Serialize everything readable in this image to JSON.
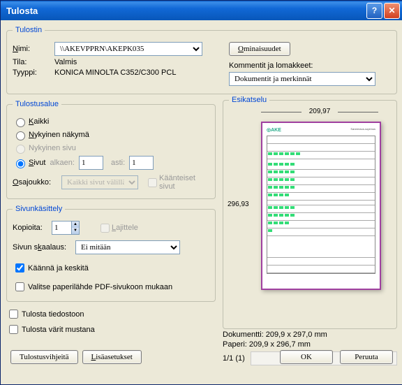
{
  "title": "Tulosta",
  "printer": {
    "legend": "Tulostin",
    "name_label": "Nimi:",
    "name_value": "\\\\AKEVPPRN\\AKEPK035",
    "status_label": "Tila:",
    "status_value": "Valmis",
    "type_label": "Tyyppi:",
    "type_value": "KONICA MINOLTA C352/C300 PCL",
    "properties_btn": "Ominaisuudet",
    "comments_label": "Kommentit ja lomakkeet:",
    "comments_value": "Dokumentit ja merkinnät"
  },
  "range": {
    "legend": "Tulostusalue",
    "all": "Kaikki",
    "current_view": "Nykyinen näkymä",
    "current_page": "Nykyinen sivu",
    "pages": "Sivut",
    "from_label": "alkaen:",
    "from_value": "1",
    "to_label": "asti:",
    "to_value": "1",
    "subset_label": "Osajoukko:",
    "subset_value": "Kaikki sivut välillä",
    "reverse": "Käänteiset sivut"
  },
  "handling": {
    "legend": "Sivunkäsittely",
    "copies_label": "Kopioita:",
    "copies_value": "1",
    "collate": "Lajittele",
    "scaling_label": "Sivun skaalaus:",
    "scaling_value": "Ei mitään",
    "rotate_center": "Käännä ja keskitä",
    "paper_source": "Valitse paperilähde PDF-sivukoon mukaan"
  },
  "misc": {
    "print_to_file": "Tulosta tiedostoon",
    "print_bw": "Tulosta värit mustana"
  },
  "preview": {
    "legend": "Esikatselu",
    "width": "209,97",
    "height": "296,93",
    "doc_info": "Dokumentti: 209,9 x 297,0 mm",
    "paper_info": "Paperi: 209,9 x 296,7 mm",
    "page_status": "1/1 (1)"
  },
  "buttons": {
    "ok": "OK",
    "cancel": "Peruuta",
    "tips": "Tulostusvihjeitä",
    "advanced": "Lisäasetukset"
  }
}
